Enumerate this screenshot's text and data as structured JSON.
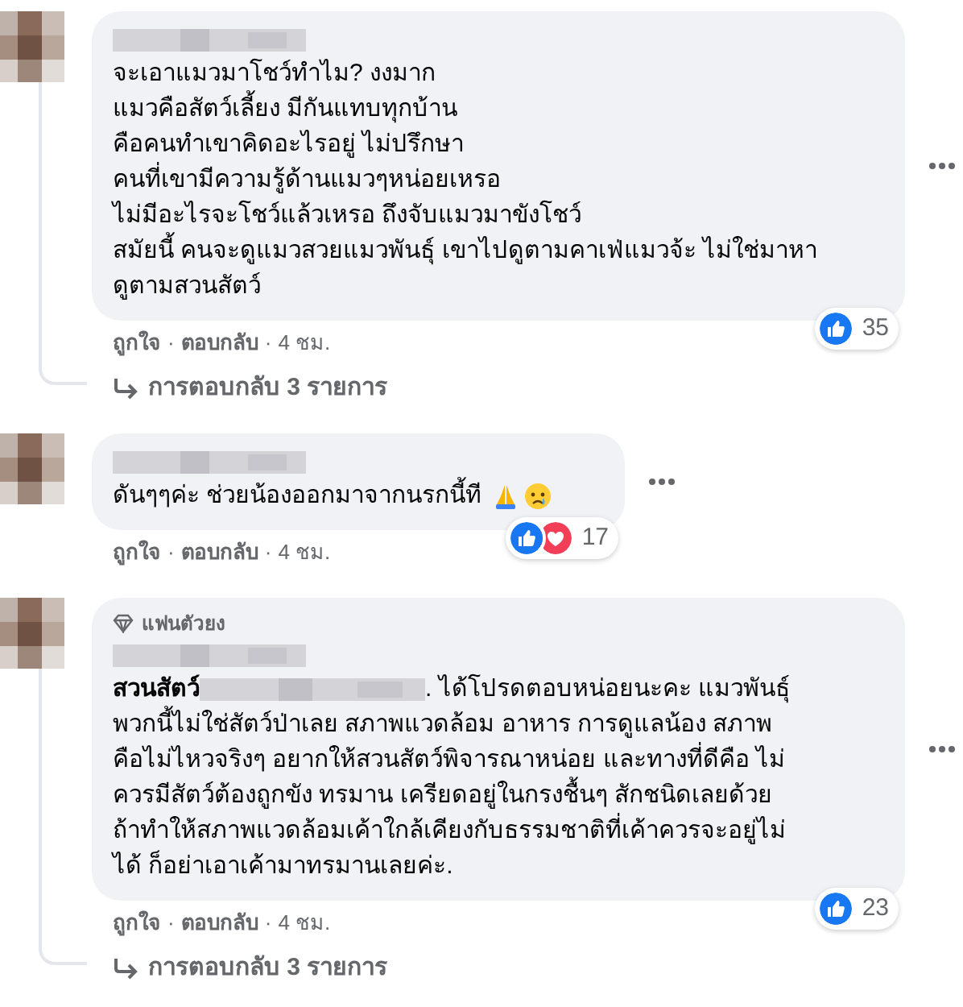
{
  "comments": [
    {
      "lines": [
        "จะเอาแมวมาโชว์ทำไม? งงมาก",
        "แมวคือสัตว์เลี้ยง มีกันแทบทุกบ้าน",
        "คือคนทำเขาคิดอะไรอยู่ ไม่ปรึกษา",
        "คนที่เขามีความรู้ด้านแมวๆหน่อยเหรอ",
        "ไม่มีอะไรจะโชว์แล้วเหรอ ถึงจับแมวมาขังโชว์",
        "สมัยนี้ คนจะดูแมวสวยแมวพันธุ์ เขาไปดูตามคาเฟ่แมวจ้ะ ไม่ใช่มาหา",
        "ดูตามสวนสัตว์"
      ],
      "has_emoji": false,
      "reactions": {
        "count": "35",
        "heart": false
      },
      "like": "ถูกใจ",
      "sep": "·",
      "reply": "ตอบกลับ",
      "time": "4 ชม.",
      "replies": "การตอบกลับ 3 รายการ"
    },
    {
      "lines": [
        "ดันๆๆค่ะ ช่วยน้องออกมาจากนรกนี้ที"
      ],
      "has_emoji": true,
      "reactions": {
        "count": "17",
        "heart": true
      },
      "like": "ถูกใจ",
      "sep": "·",
      "reply": "ตอบกลับ",
      "time": "4 ชม."
    },
    {
      "badge": "แฟนตัวยง",
      "mention": "สวนสัตว์",
      "lines": [
        ". ได้โปรดตอบหน่อยนะคะ แมวพันธุ์",
        "พวกนี้ไม่ใช่สัตว์ป่าเลย สภาพแวดล้อม อาหาร การดูแลน้อง สภาพ",
        "คือไม่ไหวจริงๆ อยากให้สวนสัตว์พิจารณาหน่อย และทางที่ดีคือ ไม่",
        "ควรมีสัตว์ต้องถูกขัง ทรมาน เครียดอยู่ในกรงชื้นๆ สักชนิดเลยด้วย",
        "ถ้าทำให้สภาพแวดล้อมเค้าใกล้เคียงกับธรรมชาติที่เค้าควรจะอยู่ไม่",
        "ได้ ก็อย่าเอาเค้ามาทรมานเลยค่ะ."
      ],
      "has_emoji": false,
      "reactions": {
        "count": "23",
        "heart": false
      },
      "like": "ถูกใจ",
      "sep": "·",
      "reply": "ตอบกลับ",
      "time": "4 ชม.",
      "replies": "การตอบกลับ 3 รายการ"
    }
  ]
}
